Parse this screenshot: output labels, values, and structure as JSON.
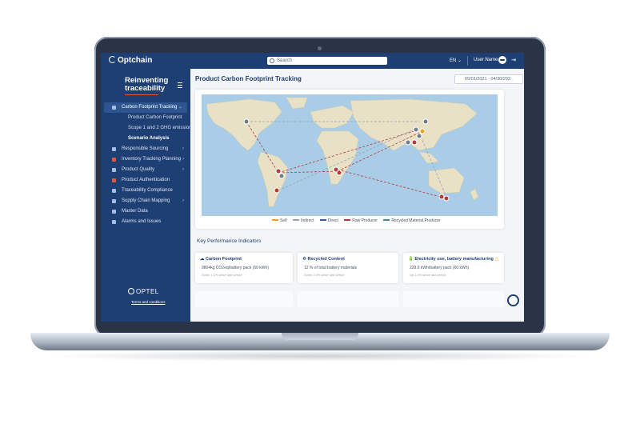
{
  "app": {
    "brand": "Optchain",
    "sidebar_title_line1": "Reinventing",
    "sidebar_title_line2": "traceability"
  },
  "topbar": {
    "search_placeholder": "Search",
    "language": "EN ⌄",
    "user_name": "User Name",
    "logout_icon": "logout-icon"
  },
  "sidebar": {
    "items": [
      {
        "label": "Carbon Footprint Tracking",
        "icon": "leaf-icon",
        "expanded": true
      },
      {
        "label": "Product Carbon Footprint"
      },
      {
        "label": "Scope 1 and 2 GHG emission"
      },
      {
        "label": "Scenario Analysis"
      },
      {
        "label": "Responsible Sourcing",
        "icon": "box-icon"
      },
      {
        "label": "Inventory Tracking Planning",
        "icon": "warehouse-icon"
      },
      {
        "label": "Product Quality",
        "icon": "clipboard-icon"
      },
      {
        "label": "Product Authentication",
        "icon": "shield-icon"
      },
      {
        "label": "Traceability Compliance",
        "icon": "check-icon"
      },
      {
        "label": "Supply Chain Mapping",
        "icon": "network-icon"
      },
      {
        "label": "Master Data",
        "icon": "database-icon"
      },
      {
        "label": "Alarms and Issues",
        "icon": "bell-icon"
      }
    ],
    "footer_logo": "OPTEL",
    "terms": "Terms and conditions"
  },
  "main": {
    "title": "Product Carbon Footprint Tracking",
    "date_range": "05/01/2021 - 04/30/202..",
    "map_legend": [
      "Self",
      "Indirect",
      "Direct",
      "Raw Producer",
      "Recycled Material Producer"
    ],
    "legend_colors": [
      "#f0a21a",
      "#9aa3b3",
      "#2f5f9f",
      "#b53a3a",
      "#3d8a9b"
    ],
    "kpi_header": "Key Performance Indicators",
    "kpis": [
      {
        "title": "Carbon Footprint",
        "value": "9804kg CO2eq/battery pack (60 kWh)",
        "sub": "Down 1.2% since last period"
      },
      {
        "title": "Recycled Content",
        "value": "12 % of total battery materials",
        "sub": "Down 2.0% since last period"
      },
      {
        "title": "Electricity use, battery manufacturing",
        "value": "229.6 kWh/battery pack (60 kWh)",
        "sub": "Up 2.4% since last period"
      }
    ]
  }
}
